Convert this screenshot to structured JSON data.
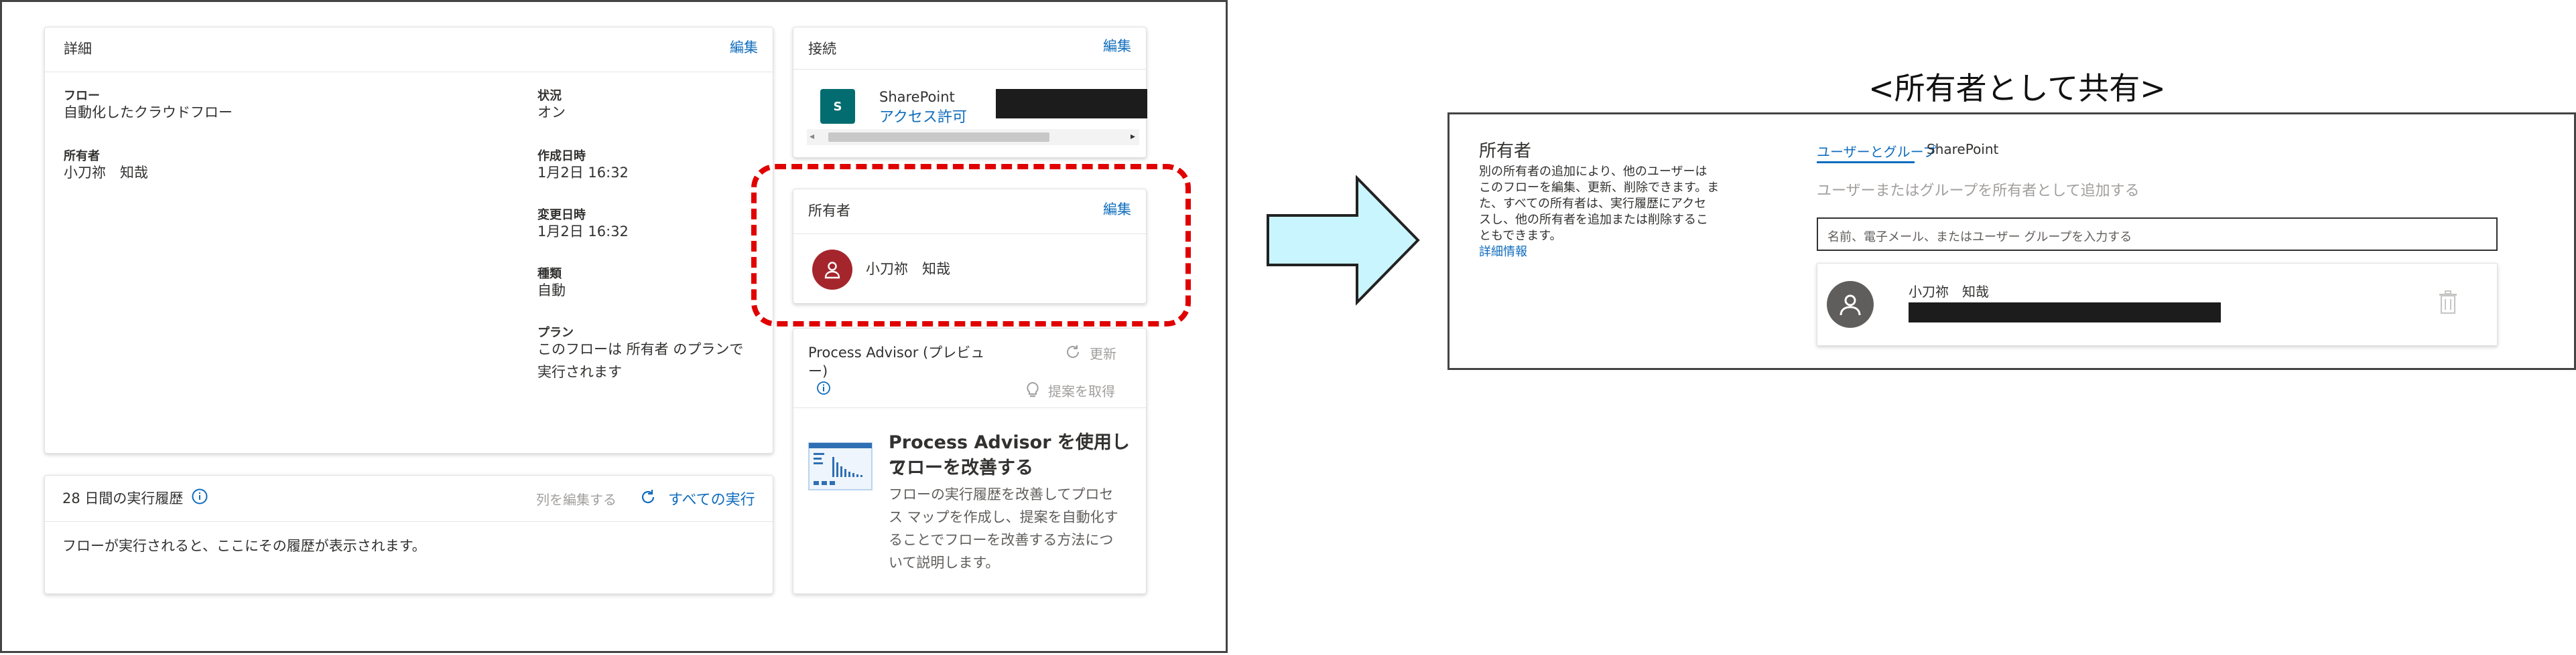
{
  "details": {
    "title": "詳細",
    "edit": "編集",
    "flow_label": "フロー",
    "flow_value": "自動化したクラウドフロー",
    "owner_label": "所有者",
    "owner_value": "小刀祢　知哉",
    "status_label": "状況",
    "status_value": "オン",
    "created_label": "作成日時",
    "created_value": "1月2日 16:32",
    "modified_label": "変更日時",
    "modified_value": "1月2日 16:32",
    "type_label": "種類",
    "type_value": "自動",
    "plan_label": "プラン",
    "plan_value_1": "このフローは 所有者 のプランで",
    "plan_value_2": "実行されます"
  },
  "history": {
    "title": "28 日間の実行履歴",
    "edit_columns": "列を編集する",
    "all_runs": "すべての実行",
    "empty_text": "フローが実行されると、ここにその履歴が表示されます。"
  },
  "connections": {
    "title": "接続",
    "edit": "編集",
    "sharepoint_name": "SharePoint",
    "access_link": "アクセス許可"
  },
  "owners_card": {
    "title": "所有者",
    "edit": "編集",
    "owner_name": "小刀祢　知哉"
  },
  "process_advisor": {
    "title_line1": "Process Advisor (プレビュ",
    "title_line2": "ー)",
    "refresh": "更新",
    "get_suggestions": "提案を取得",
    "promo_title_line1": "Process Advisor を使用して",
    "promo_title_line2": "フローを改善する",
    "promo_body_1": "フローの実行履歴を改善してプロセ",
    "promo_body_2": "ス マップを作成し、提案を自動化す",
    "promo_body_3": "ることでフローを改善する方法につ",
    "promo_body_4": "いて説明します。"
  },
  "share_panel": {
    "caption": "<所有者として共有>",
    "title": "所有者",
    "desc_1": "別の所有者の追加により、他のユーザーは",
    "desc_2": "このフローを編集、更新、削除できます。ま",
    "desc_3": "た、すべての所有者は、実行履歴にアクセ",
    "desc_4": "スし、他の所有者を追加または削除するこ",
    "desc_5": "ともできます。",
    "more_info": "詳細情報",
    "tab_users": "ユーザーとグループ",
    "tab_sharepoint": "SharePoint",
    "hint": "ユーザーまたはグループを所有者として追加する",
    "input_placeholder": "名前、電子メール、またはユーザー グループを入力する",
    "owner_name": "小刀祢　知哉"
  },
  "colors": {
    "accent": "#0f6cbd",
    "highlight": "#e00000",
    "arrow_fill": "#c9f5ff",
    "owner_avatar": "#a4262c",
    "sharepoint_icon": "#036c70"
  }
}
